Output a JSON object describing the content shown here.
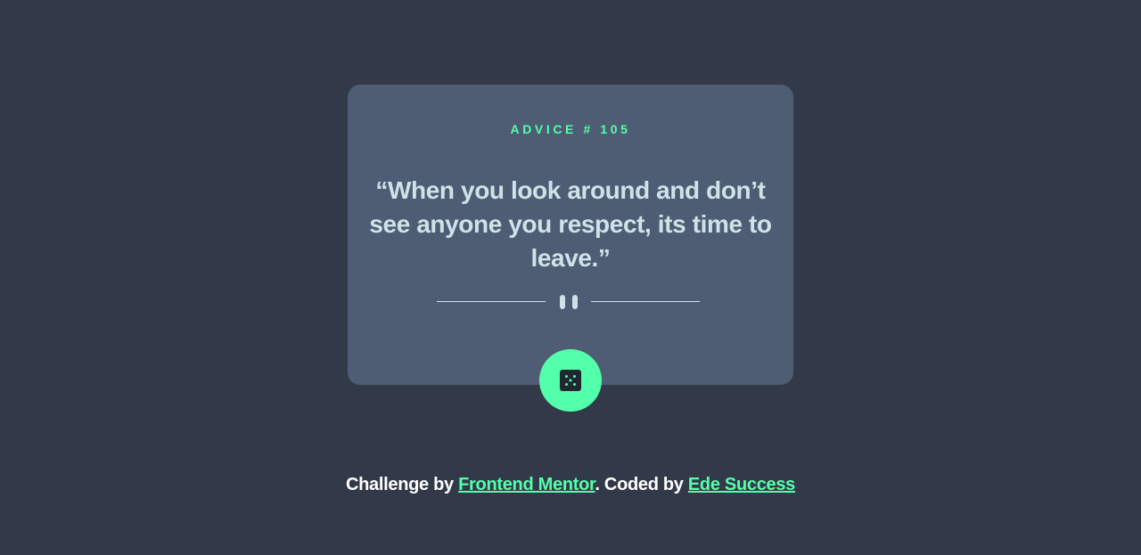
{
  "card": {
    "advice_id_label": "ADVICE # 105",
    "quote_open": "“",
    "quote_text": "When you look around and don’t see anyone you respect, its time to leave.",
    "quote_close": "”"
  },
  "dice_button": {
    "icon": "dice-icon",
    "color": "#53ffaa"
  },
  "attribution": {
    "prefix": "Challenge by ",
    "link1": "Frontend Mentor",
    "middle": ". Coded by ",
    "link2": "Ede Success"
  },
  "colors": {
    "background": "#323a49",
    "card": "#4e5d73",
    "accent": "#53ffaa",
    "text": "#cee3e9"
  }
}
